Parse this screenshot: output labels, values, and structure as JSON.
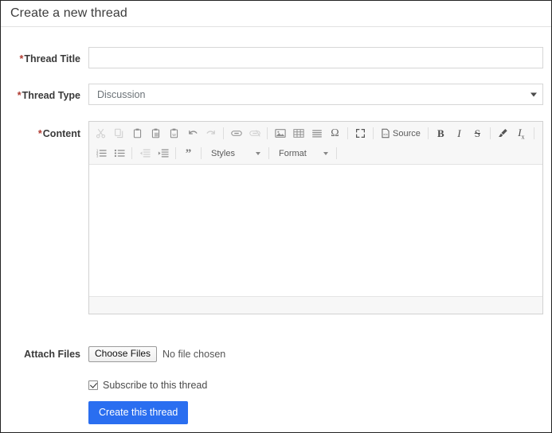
{
  "header": {
    "title": "Create a new thread"
  },
  "form": {
    "required_marker": "*",
    "thread_title": {
      "label": "Thread Title",
      "value": "",
      "placeholder": ""
    },
    "thread_type": {
      "label": "Thread Type",
      "selected": "Discussion",
      "options": [
        "Discussion"
      ]
    },
    "content": {
      "label": "Content",
      "value": ""
    },
    "attach_files": {
      "label": "Attach Files",
      "button_label": "Choose Files",
      "status_text": "No file chosen"
    },
    "subscribe": {
      "label": "Subscribe to this thread",
      "checked": true
    },
    "submit": {
      "label": "Create this thread"
    }
  },
  "editor": {
    "toolbar_row1": [
      {
        "name": "cut-icon",
        "title": "Cut",
        "state": "disabled"
      },
      {
        "name": "copy-icon",
        "title": "Copy",
        "state": "disabled"
      },
      {
        "name": "paste-icon",
        "title": "Paste",
        "state": "normal"
      },
      {
        "name": "paste-text-icon",
        "title": "Paste as plain text",
        "state": "normal"
      },
      {
        "name": "paste-word-icon",
        "title": "Paste from Word",
        "state": "normal"
      },
      {
        "name": "undo-icon",
        "title": "Undo",
        "state": "disabled"
      },
      {
        "name": "redo-icon",
        "title": "Redo",
        "state": "disabled"
      },
      {
        "name": "link-icon",
        "title": "Link",
        "state": "normal"
      },
      {
        "name": "unlink-icon",
        "title": "Unlink",
        "state": "disabled"
      },
      {
        "name": "image-icon",
        "title": "Image",
        "state": "normal"
      },
      {
        "name": "table-icon",
        "title": "Table",
        "state": "normal"
      },
      {
        "name": "horizontal-rule-icon",
        "title": "Horizontal Line",
        "state": "normal"
      },
      {
        "name": "special-character-icon",
        "title": "Insert Special Character",
        "glyph": "Ω",
        "state": "normal"
      },
      {
        "name": "maximize-icon",
        "title": "Maximize",
        "state": "normal"
      },
      {
        "name": "source-button",
        "title": "Source",
        "label": "Source",
        "state": "normal"
      },
      {
        "name": "bold-icon",
        "title": "Bold",
        "glyph": "B",
        "state": "normal"
      },
      {
        "name": "italic-icon",
        "title": "Italic",
        "glyph": "I",
        "state": "normal"
      },
      {
        "name": "strikethrough-icon",
        "title": "Strikethrough",
        "glyph": "S",
        "state": "normal"
      },
      {
        "name": "remove-format-icon",
        "title": "Remove Format",
        "state": "normal"
      },
      {
        "name": "subscript-icon",
        "title": "Subscript",
        "glyph": "Ix",
        "state": "normal"
      }
    ],
    "toolbar_row2": [
      {
        "name": "numbered-list-icon",
        "title": "Insert/Remove Numbered List",
        "state": "normal"
      },
      {
        "name": "bulleted-list-icon",
        "title": "Insert/Remove Bulleted List",
        "state": "normal"
      },
      {
        "name": "decrease-indent-icon",
        "title": "Decrease Indent",
        "state": "disabled"
      },
      {
        "name": "increase-indent-icon",
        "title": "Increase Indent",
        "state": "normal"
      },
      {
        "name": "blockquote-icon",
        "title": "Block Quote",
        "glyph": "”",
        "state": "normal"
      }
    ],
    "styles_dropdown": {
      "label": "Styles"
    },
    "format_dropdown": {
      "label": "Format"
    }
  },
  "colors": {
    "accent": "#2a6ef0",
    "required": "#b03a30",
    "toolbar_bg": "#f7f7f7",
    "border": "#d1d1d1",
    "text": "#333333"
  }
}
